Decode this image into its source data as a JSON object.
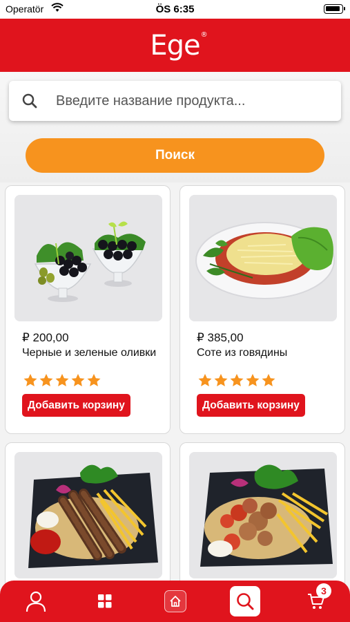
{
  "status_bar": {
    "carrier": "Operatör",
    "time": "ÖS 6:35"
  },
  "header": {
    "logo": "Ege",
    "logo_mark": "®"
  },
  "search": {
    "placeholder": "Введите название продукта...",
    "button_label": "Поиск"
  },
  "products": [
    {
      "price": "₽ 200,00",
      "name": "Черные и зеленые оливки",
      "rating": 5,
      "add_label": "Добавить корзину"
    },
    {
      "price": "₽ 385,00",
      "name": "Соте из говядины",
      "rating": 5,
      "add_label": "Добавить корзину"
    },
    {
      "price": "",
      "name": "",
      "rating": 0,
      "add_label": ""
    },
    {
      "price": "",
      "name": "",
      "rating": 0,
      "add_label": ""
    }
  ],
  "tabbar": {
    "cart_count": "3",
    "icons": [
      "user-icon",
      "grid-icon",
      "home-icon",
      "search-icon",
      "cart-icon"
    ]
  },
  "colors": {
    "brand_red": "#e0141d",
    "accent_orange": "#f7931e",
    "star": "#f7931e"
  }
}
